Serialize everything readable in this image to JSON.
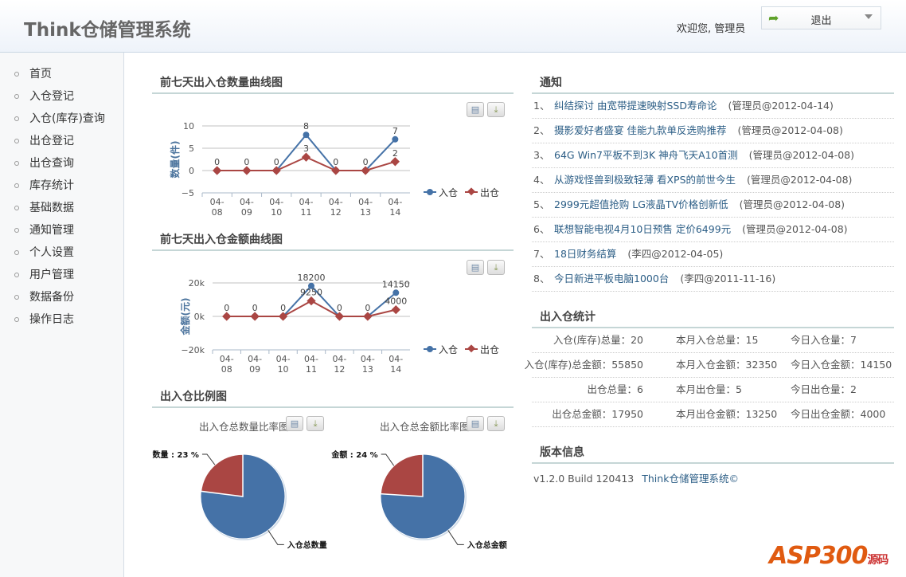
{
  "header": {
    "title": "Think仓储管理系统",
    "welcome": "欢迎您, 管理员",
    "logout_label": "退出"
  },
  "sidebar": {
    "items": [
      {
        "label": "首页"
      },
      {
        "label": "入仓登记"
      },
      {
        "label": "入仓(库存)查询"
      },
      {
        "label": "出仓登记"
      },
      {
        "label": "出仓查询"
      },
      {
        "label": "库存统计"
      },
      {
        "label": "基础数据"
      },
      {
        "label": "通知管理"
      },
      {
        "label": "个人设置"
      },
      {
        "label": "用户管理"
      },
      {
        "label": "数据备份"
      },
      {
        "label": "操作日志"
      }
    ]
  },
  "sections": {
    "qty_chart": "前七天出入仓数量曲线图",
    "amt_chart": "前七天出入仓金额曲线图",
    "ratio": "出入仓比例图",
    "notice": "通知",
    "stats": "出入仓统计",
    "version": "版本信息"
  },
  "colors": {
    "in": "#4572a7",
    "out": "#aa4643"
  },
  "chart_data": [
    {
      "type": "line",
      "ylabel": "数量(件)",
      "categories": [
        "04-08",
        "04-09",
        "04-10",
        "04-11",
        "04-12",
        "04-13",
        "04-14"
      ],
      "ylim": [
        -5,
        10
      ],
      "yticks": [
        "10",
        "5",
        "0",
        "−5"
      ],
      "ytick_values": [
        10,
        5,
        0,
        -5
      ],
      "grid": true,
      "legend": "right",
      "series": [
        {
          "name": "入仓",
          "values": [
            0,
            0,
            0,
            8,
            0,
            0,
            7
          ]
        },
        {
          "name": "出仓",
          "values": [
            0,
            0,
            0,
            3,
            0,
            0,
            2
          ]
        }
      ]
    },
    {
      "type": "line",
      "ylabel": "金额(元)",
      "categories": [
        "04-08",
        "04-09",
        "04-10",
        "04-11",
        "04-12",
        "04-13",
        "04-14"
      ],
      "ylim": [
        -20000,
        20000
      ],
      "yticks": [
        "20k",
        "0k",
        "−20k"
      ],
      "ytick_values": [
        20000,
        0,
        -20000
      ],
      "grid": true,
      "legend": "right",
      "series": [
        {
          "name": "入仓",
          "values": [
            0,
            0,
            0,
            18200,
            0,
            0,
            14150
          ]
        },
        {
          "name": "出仓",
          "values": [
            0,
            0,
            0,
            9250,
            0,
            0,
            4000
          ]
        }
      ]
    },
    {
      "type": "pie",
      "title": "出入仓总数量比率图",
      "slices": [
        {
          "label": "数量 : 23 %",
          "value": 23
        },
        {
          "label": "入仓总数量",
          "value": 77
        }
      ]
    },
    {
      "type": "pie",
      "title": "出入仓总金额比率图",
      "slices": [
        {
          "label": "金额 : 24 %",
          "value": 24
        },
        {
          "label": "入仓总金额",
          "value": 76
        }
      ]
    }
  ],
  "notices": [
    {
      "n": "1、",
      "title": "纠结探讨 由宽带提速映射SSD寿命论",
      "meta": "(管理员@2012-04-14)"
    },
    {
      "n": "2、",
      "title": "摄影爱好者盛宴 佳能九款单反选购推荐",
      "meta": "(管理员@2012-04-08)"
    },
    {
      "n": "3、",
      "title": "64G Win7平板不到3K 神舟飞天A10首测",
      "meta": "(管理员@2012-04-08)"
    },
    {
      "n": "4、",
      "title": "从游戏怪兽到极致轻薄 看XPS的前世今生",
      "meta": "(管理员@2012-04-08)"
    },
    {
      "n": "5、",
      "title": "2999元超值抢购 LG液晶TV价格创新低",
      "meta": "(管理员@2012-04-08)"
    },
    {
      "n": "6、",
      "title": "联想智能电视4月10日预售 定价6499元",
      "meta": "(管理员@2012-04-08)"
    },
    {
      "n": "7、",
      "title": "18日财务结算",
      "meta": "(李四@2012-04-05)"
    },
    {
      "n": "8、",
      "title": "今日新进平板电脑1000台",
      "meta": "(李四@2011-11-16)"
    }
  ],
  "stats": [
    [
      "入仓(库存)总量：20",
      "本月入仓总量：15",
      "今日入仓量：7"
    ],
    [
      "入仓(库存)总金额：55850",
      "本月入仓金额：32350",
      "今日入仓金额：14150"
    ],
    [
      "出仓总量：6",
      "本月出仓量：5",
      "今日出仓量：2"
    ],
    [
      "出仓总金额：17950",
      "本月出仓金额：13250",
      "今日出仓金额：4000"
    ]
  ],
  "version": {
    "build": "v1.2.0 Build 120413",
    "product": "Think仓储管理系统©"
  },
  "watermark": "ASP300源码"
}
